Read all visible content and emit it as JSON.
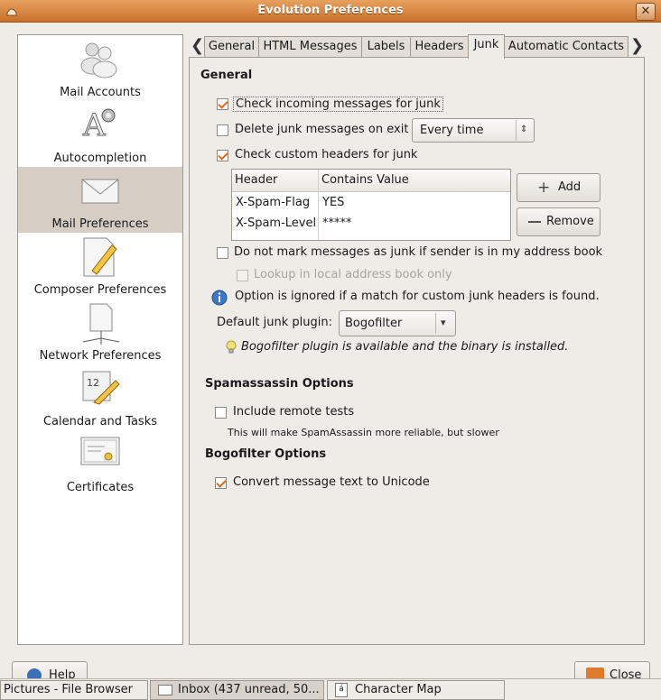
{
  "window": {
    "title": "Evolution Preferences"
  },
  "sidebar": {
    "items": [
      {
        "label": "Mail Accounts",
        "icon": "mail-accounts-icon"
      },
      {
        "label": "Autocompletion",
        "icon": "autocompletion-icon"
      },
      {
        "label": "Mail Preferences",
        "icon": "mail-preferences-icon",
        "selected": true
      },
      {
        "label": "Composer Preferences",
        "icon": "composer-icon"
      },
      {
        "label": "Network Preferences",
        "icon": "network-icon"
      },
      {
        "label": "Calendar and Tasks",
        "icon": "calendar-icon"
      },
      {
        "label": "Certificates",
        "icon": "certificate-icon"
      }
    ]
  },
  "tabs": [
    "General",
    "HTML Messages",
    "Labels",
    "Headers",
    "Junk",
    "Automatic Contacts"
  ],
  "active_tab": "Junk",
  "junk": {
    "general_heading": "General",
    "check_incoming": {
      "label": "Check incoming messages for junk",
      "checked": true
    },
    "delete_on_exit": {
      "label": "Delete junk messages on exit",
      "checked": false
    },
    "delete_frequency": "Every time",
    "check_custom_headers": {
      "label": "Check custom headers for junk",
      "checked": true
    },
    "table": {
      "columns": [
        "Header",
        "Contains Value"
      ],
      "rows": [
        {
          "header": "X-Spam-Flag",
          "value": "YES"
        },
        {
          "header": "X-Spam-Level",
          "value": "*****"
        }
      ]
    },
    "add_button": "Add",
    "remove_button": "Remove",
    "do_not_mark": {
      "label": "Do not mark messages as junk if sender is in my address book",
      "checked": false
    },
    "lookup_local": {
      "label": "Lookup in local address book only",
      "checked": false,
      "disabled": true
    },
    "info_text": "Option is ignored if a match for custom junk headers is found.",
    "default_plugin_label": "Default junk plugin:",
    "default_plugin_value": "Bogofilter",
    "plugin_status": "Bogofilter plugin is available and the binary is installed.",
    "spamassassin_heading": "Spamassassin Options",
    "include_remote": {
      "label": "Include remote tests",
      "checked": false
    },
    "include_remote_hint": "This will make SpamAssassin more reliable, but slower",
    "bogofilter_heading": "Bogofilter Options",
    "convert_unicode": {
      "label": "Convert message text to Unicode",
      "checked": true
    }
  },
  "footer": {
    "help_button": "Help",
    "close_button": "Close"
  },
  "taskbar": [
    {
      "label": "Pictures - File Browser"
    },
    {
      "label": "Inbox (437 unread, 50...",
      "active": true
    },
    {
      "label": "Character Map"
    }
  ],
  "colors": {
    "titlebar": "#d98a46",
    "check_accent": "#d86c1c",
    "selection": "#d6cec3"
  }
}
